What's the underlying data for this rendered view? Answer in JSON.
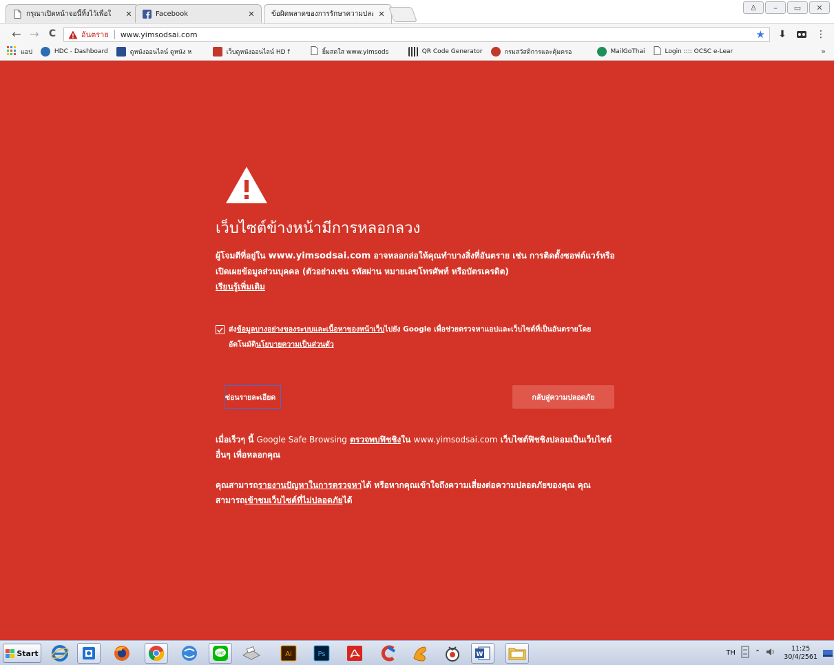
{
  "tabs": [
    {
      "title": "กรุณาเปิดหน้าจอนี้ทิ้งไว้เพื่อใ",
      "icon": "page-icon"
    },
    {
      "title": "Facebook",
      "icon": "facebook-icon"
    },
    {
      "title": "ข้อผิดพลาดของการรักษาความปลอ",
      "icon": "none"
    }
  ],
  "window": {
    "minimize": "–",
    "maximize": "▭",
    "close": "✕",
    "profile": "♙"
  },
  "toolbar": {
    "back": "←",
    "forward": "→",
    "reload": "C",
    "security_label": "อันตราย",
    "url": "www.yimsodsai.com",
    "star": "★",
    "download": "⬇",
    "menu": "⋮"
  },
  "bookmarks": [
    {
      "label": "แอป",
      "color": "#e74c3c"
    },
    {
      "label": "HDC - Dashboard",
      "color": "#2d6db3"
    },
    {
      "label": "ดูหนังออนไลน์ ดูหนัง ห",
      "color": "#2a4d8f"
    },
    {
      "label": "เว็บดูหนังออนไลน์ HD f",
      "color": "#c0392b"
    },
    {
      "label": "ยิ้มสดใส www.yimsods",
      "color": "#bbbbbb"
    },
    {
      "label": "QR Code Generator",
      "color": "#333333"
    },
    {
      "label": "กรมสวัสดิการและคุ้มครอ",
      "color": "#c0392b"
    },
    {
      "label": "MailGoThai",
      "color": "#1f8f5a"
    },
    {
      "label": "Login :::: OCSC e-Lear",
      "color": "#bbbbbb"
    }
  ],
  "bookmarks_more": "»",
  "interstitial": {
    "heading": "เว็บไซต์ข้างหน้ามีการหลอกลวง",
    "intro_pre": "ผู้โจมตีที่อยู่ใน",
    "intro_site": "www.yimsodsai.com",
    "intro_post": "อาจหลอกล่อให้คุณทำบางสิ่งที่อันตราย เช่น การติดตั้งซอฟต์แวร์หรือเปิดเผยข้อมูลส่วนบุคคล (ตัวอย่างเช่น รหัสผ่าน หมายเลขโทรศัพท์ หรือบัตรเครดิต)",
    "learn_more": "เรียนรู้เพิ่มเติม",
    "report_pre": "ส่ง",
    "report_link1": "ข้อมูลบางอย่างของระบบและเนื้อหาของหน้าเว็บ",
    "report_mid": "ไปยัง Google เพื่อช่วยตรวจหาแอปและเว็บไซต์ที่เป็นอันตรายโดยอัตโนมัติ",
    "report_link2": "นโยบายความเป็นส่วนตัว",
    "report_checked": true,
    "details_button": "ซ่อนรายละเอียด",
    "back_button": "กลับสู่ความปลอดภัย",
    "detail1_pre": "เมื่อเร็วๆ นี้",
    "detail1_gsb": "Google Safe Browsing",
    "detail1_link": "ตรวจพบฟิชชิง",
    "detail1_in": "ใน",
    "detail1_site": "www.yimsodsai.com",
    "detail1_post": "เว็บไซต์ฟิชชิงปลอมเป็นเว็บไซต์อื่นๆ เพื่อหลอกคุณ",
    "detail2_pre": "คุณสามารถ",
    "detail2_link1": "รายงานปัญหาในการตรวจหา",
    "detail2_mid": "ได้ หรือหากคุณเข้าใจถึงความเสี่ยงต่อความปลอดภัยของคุณ คุณสามารถ",
    "detail2_link2": "เข้าชมเว็บไซต์ที่ไม่ปลอดภัย",
    "detail2_post": "ได้"
  },
  "taskbar": {
    "start_label": "Start",
    "apps": [
      "ie-icon",
      "outlook-icon",
      "firefox-icon",
      "chrome-icon",
      "messenger-icon",
      "line-icon",
      "scanner-icon",
      "illustrator-icon",
      "photoshop-icon",
      "acrobat-icon",
      "ccleaner-icon",
      "sketch-icon",
      "recorder-icon",
      "word-icon",
      "folder-icon"
    ],
    "lang": "TH",
    "time": "11:25",
    "date": "30/4/2561"
  },
  "colors": {
    "page_bg": "#d33427",
    "back_button_bg": "#e0574b",
    "danger": "#c5221f",
    "star": "#3b78e7"
  }
}
